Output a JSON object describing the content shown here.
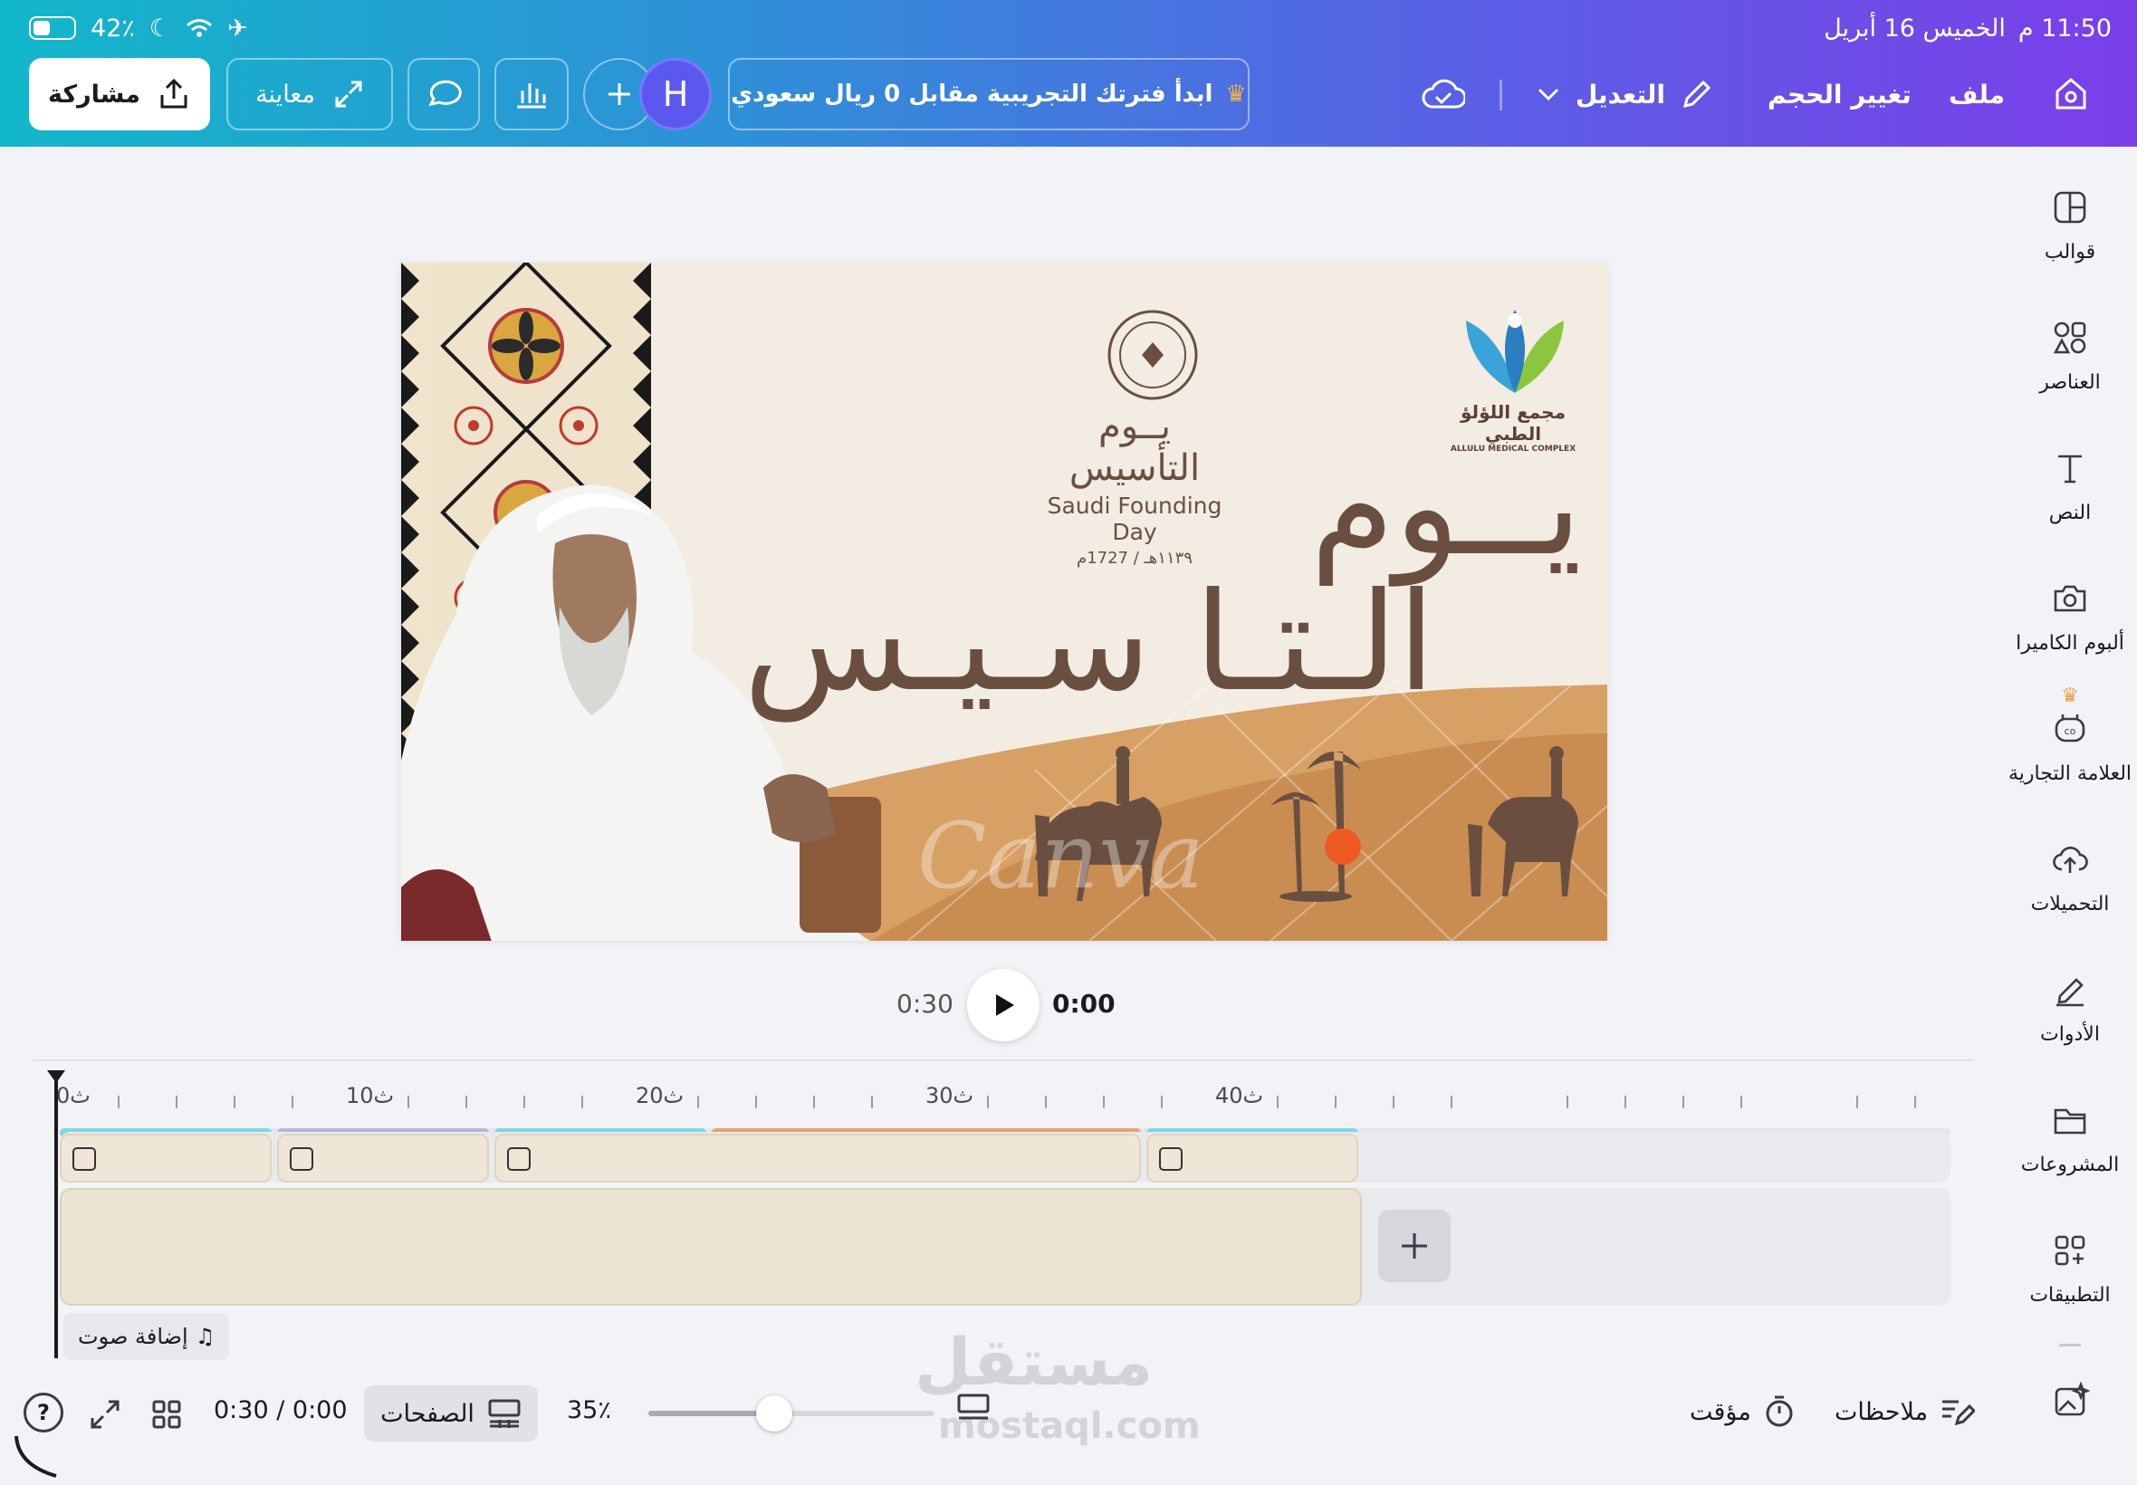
{
  "status_bar": {
    "battery": "42٪",
    "time": "11:50 م",
    "date": "الخميس 16 أبريل"
  },
  "toolbar": {
    "share_label": "مشاركة",
    "preview_label": "معاينة",
    "avatar_letter": "H",
    "trial_label": "ابدأ فترتك التجريبية مقابل 0 ريال سعودي",
    "edit_label": "التعديل",
    "resize_label": "تغيير الحجم",
    "file_label": "ملف"
  },
  "sidebar": {
    "items": [
      {
        "label": "قوالب",
        "icon": "templates-icon"
      },
      {
        "label": "العناصر",
        "icon": "elements-icon"
      },
      {
        "label": "النص",
        "icon": "text-icon"
      },
      {
        "label": "ألبوم الكاميرا",
        "icon": "camera-icon"
      },
      {
        "label": "العلامة التجارية",
        "icon": "brand-icon"
      },
      {
        "label": "التحميلات",
        "icon": "upload-cloud-icon"
      },
      {
        "label": "الأدوات",
        "icon": "draw-tools-icon"
      },
      {
        "label": "المشروعات",
        "icon": "folder-icon"
      },
      {
        "label": "التطبيقات",
        "icon": "apps-icon"
      }
    ]
  },
  "design": {
    "title_line1": "يــوم",
    "title_line2": "الـتـا سـيـس",
    "seal_arabic": "يــوم التأسيس",
    "seal_english": "Saudi Founding Day",
    "seal_dates": "١١٣٩هـ / 1727م",
    "logo_arabic": "مجمع اللؤلؤ الطبي",
    "logo_english": "ALLULU MEDICAL COMPLEX",
    "canva_watermark": "Canva"
  },
  "playback": {
    "current": "0:00",
    "total": "0:30"
  },
  "timeline": {
    "tick_labels": [
      "0ث",
      "10ث",
      "20ث",
      "30ث",
      "40ث"
    ],
    "add_audio_label": "إضافة صوت"
  },
  "bottom": {
    "time_display": "0:30 / 0:00",
    "pages_label": "الصفحات",
    "zoom": "35٪",
    "zoom_fraction": 0.44,
    "timer_label": "مؤقت",
    "notes_label": "ملاحظات"
  },
  "overlay_watermark": {
    "arabic": "مستقل",
    "latin": "mostaql.com"
  },
  "colors": {
    "accent_purple": "#5b58f0",
    "title_brown": "#6a4f40",
    "segment_cyan": "#7fd7e3",
    "segment_lavender": "#b9b4d8",
    "segment_orange": "#e3a46b"
  }
}
